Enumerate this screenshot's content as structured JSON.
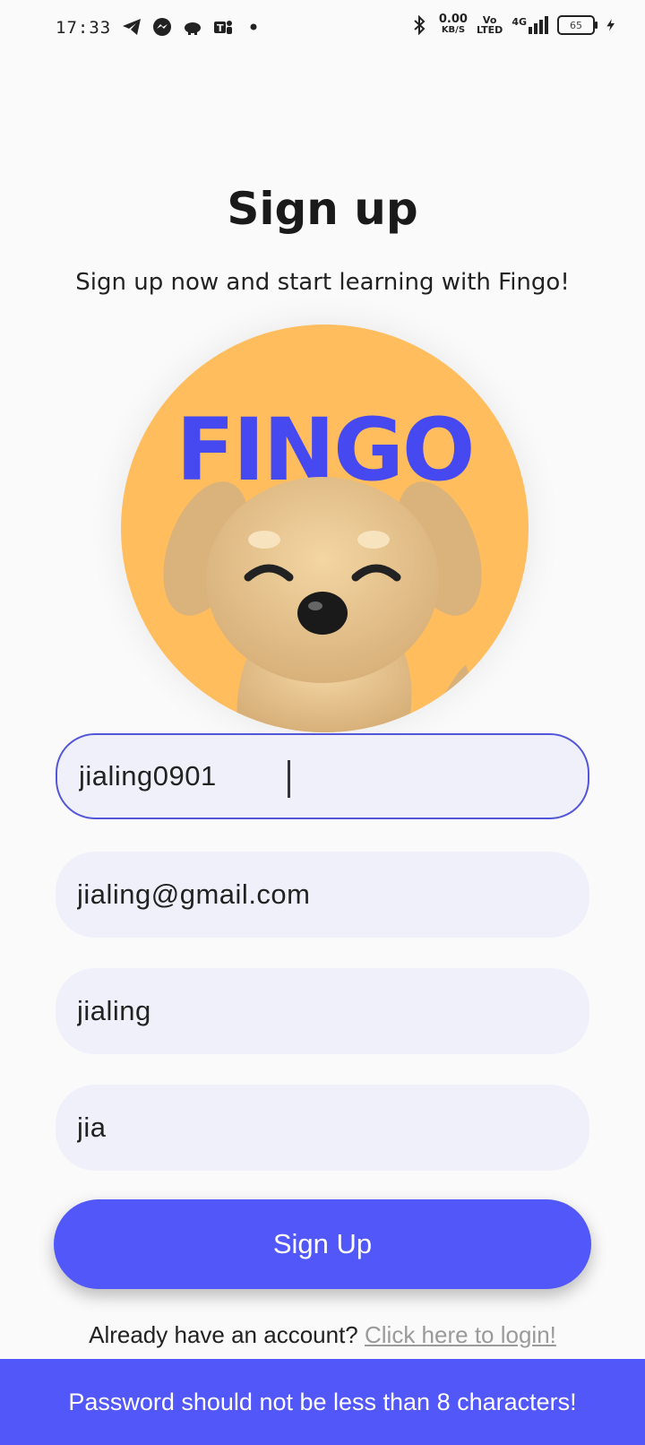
{
  "status_bar": {
    "time": "17:33",
    "net_speed": "0.00",
    "net_unit": "KB/S",
    "volte_top": "Vo",
    "volte_bottom": "LTED",
    "network": "4G",
    "battery": "65",
    "icons": [
      "telegram-icon",
      "messenger-icon",
      "piggy-bank-icon",
      "teams-icon",
      "dot-icon",
      "bluetooth-icon",
      "signal-icon",
      "charging-icon"
    ]
  },
  "header": {
    "title": "Sign up",
    "subtitle": "Sign up now and start learning with Fingo!"
  },
  "logo": {
    "word": "FINGO",
    "circle_color": "#ffbd5d",
    "word_color": "#4649ef"
  },
  "form": {
    "username": "jialing0901",
    "email": "jialing@gmail.com",
    "password": "jialing",
    "confirm_password": "jia"
  },
  "actions": {
    "signup_label": "Sign Up",
    "login_prompt": "Already have an account?",
    "login_link": "Click here to login!"
  },
  "toast": {
    "message": "Password should not be less than 8 characters!"
  },
  "colors": {
    "accent": "#5157f9",
    "field_bg": "#f0f0fa"
  }
}
